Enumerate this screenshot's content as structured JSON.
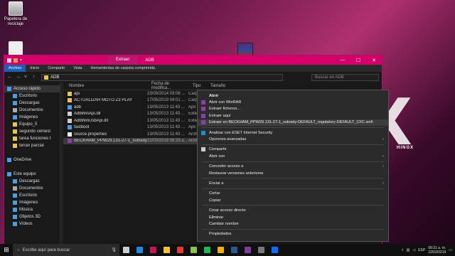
{
  "desktop": {
    "recycle_bin_label": "Papelera de reciclaje",
    "brand_text": "HINOX",
    "big_letter": "X"
  },
  "window": {
    "tab_extract": "Extraer",
    "title": "ADB",
    "ribbon_tabs": [
      "Archivo",
      "Inicio",
      "Compartir",
      "Vista",
      "Herramientas de carpeta comprimida"
    ],
    "address": "ADB",
    "search_placeholder": "Buscar en ADB",
    "controls": {
      "minimize": "—",
      "maximize": "☐",
      "close": "✕"
    }
  },
  "nav_pane": [
    {
      "label": "Acceso rápido",
      "indent": false,
      "color": "#4a9de0"
    },
    {
      "label": "Escritorio",
      "indent": true,
      "color": "#4a9de0"
    },
    {
      "label": "Descargas",
      "indent": true,
      "color": "#4a9de0"
    },
    {
      "label": "Documentos",
      "indent": true,
      "color": "#aaaaaa"
    },
    {
      "label": "Imágenes",
      "indent": true,
      "color": "#4a9de0"
    },
    {
      "label": "Equipo_5",
      "indent": true,
      "color": "#e8c35a"
    },
    {
      "label": "segundo cemest",
      "indent": true,
      "color": "#e8c35a"
    },
    {
      "label": "tarea funciones t",
      "indent": true,
      "color": "#e8c35a"
    },
    {
      "label": "tercer parcial",
      "indent": true,
      "color": "#e8c35a"
    },
    {
      "label": "",
      "indent": false,
      "color": ""
    },
    {
      "label": "OneDrive",
      "indent": false,
      "color": "#4a9de0"
    },
    {
      "label": "",
      "indent": false,
      "color": ""
    },
    {
      "label": "Este equipo",
      "indent": false,
      "color": "#4a9de0"
    },
    {
      "label": "Descargas",
      "indent": true,
      "color": "#4a9de0"
    },
    {
      "label": "Documentos",
      "indent": true,
      "color": "#aaaaaa"
    },
    {
      "label": "Escritorio",
      "indent": true,
      "color": "#4a9de0"
    },
    {
      "label": "Imágenes",
      "indent": true,
      "color": "#4a9de0"
    },
    {
      "label": "Música",
      "indent": true,
      "color": "#4a9de0"
    },
    {
      "label": "Objetos 3D",
      "indent": true,
      "color": "#4a9de0"
    },
    {
      "label": "Vídeos",
      "indent": true,
      "color": "#4a9de0"
    }
  ],
  "file_columns": [
    "Nombre",
    "Fecha de modifica...",
    "Tipo",
    "Tamaño"
  ],
  "files": [
    {
      "name": "api",
      "date": "23/09/2014 03:06 ...",
      "type": "Carp",
      "icon": "folder"
    },
    {
      "name": "ACTUALIZAR MOTO Z3 PLAY",
      "date": "17/05/2019 04:01 ...",
      "type": "Carp",
      "icon": "folder"
    },
    {
      "name": "adb",
      "date": "13/05/2013 11:43 ...",
      "type": "Apli",
      "icon": "exe"
    },
    {
      "name": "AdbWinApi.dll",
      "date": "13/05/2013 11:43 ...",
      "type": "Exte",
      "icon": "dll"
    },
    {
      "name": "AdbWinUsbApi.dll",
      "date": "13/05/2013 11:43 ...",
      "type": "Exte",
      "icon": "dll"
    },
    {
      "name": "fastboot",
      "date": "13/05/2013 11:43 ...",
      "type": "Apli",
      "icon": "exe"
    },
    {
      "name": "source.properties",
      "date": "13/05/2013 11:43 ...",
      "type": "Arch",
      "icon": "file"
    },
    {
      "name": "BECKHAM_PPW29.131-27-1_subsidy-DEF...",
      "date": "22/03/2019 08:29 a...",
      "type": "Arch",
      "icon": "rar"
    }
  ],
  "context_menu": [
    {
      "label": "Abrir",
      "bold": true,
      "icon": "",
      "arrow": false,
      "sep_after": false
    },
    {
      "label": "Abrir con WinRAR",
      "bold": false,
      "icon": "rar",
      "arrow": false,
      "sep_after": false
    },
    {
      "label": "Extraer ficheros...",
      "bold": false,
      "icon": "rar",
      "arrow": false,
      "sep_after": false
    },
    {
      "label": "Extraer aquí",
      "bold": false,
      "icon": "rar",
      "arrow": false,
      "sep_after": false
    },
    {
      "label": "Extraer en BECKHAM_PPW29.131-27-1_subsidy-DEFAULT_regulatory-DEFAULT_CFC.xml\\",
      "bold": false,
      "icon": "rar",
      "arrow": false,
      "sep_after": true,
      "highlight": true
    },
    {
      "label": "Analizar con ESET Internet Security",
      "bold": false,
      "icon": "eset",
      "arrow": false,
      "sep_after": false
    },
    {
      "label": "Opciones avanzadas",
      "bold": false,
      "icon": "",
      "arrow": true,
      "sep_after": true
    },
    {
      "label": "Compartir",
      "bold": false,
      "icon": "share",
      "arrow": false,
      "sep_after": false
    },
    {
      "label": "Abrir con",
      "bold": false,
      "icon": "",
      "arrow": true,
      "sep_after": true
    },
    {
      "label": "Conceder acceso a",
      "bold": false,
      "icon": "",
      "arrow": true,
      "sep_after": false
    },
    {
      "label": "Restaurar versiones anteriores",
      "bold": false,
      "icon": "",
      "arrow": false,
      "sep_after": true
    },
    {
      "label": "Enviar a",
      "bold": false,
      "icon": "",
      "arrow": true,
      "sep_after": true
    },
    {
      "label": "Cortar",
      "bold": false,
      "icon": "",
      "arrow": false,
      "sep_after": false
    },
    {
      "label": "Copiar",
      "bold": false,
      "icon": "",
      "arrow": false,
      "sep_after": true
    },
    {
      "label": "Crear acceso directo",
      "bold": false,
      "icon": "",
      "arrow": false,
      "sep_after": false
    },
    {
      "label": "Eliminar",
      "bold": false,
      "icon": "",
      "arrow": false,
      "sep_after": false
    },
    {
      "label": "Cambiar nombre",
      "bold": false,
      "icon": "",
      "arrow": false,
      "sep_after": true
    },
    {
      "label": "Propiedades",
      "bold": false,
      "icon": "",
      "arrow": false,
      "sep_after": false
    }
  ],
  "taskbar": {
    "search_placeholder": "Escribe aquí para buscar",
    "apps": [
      {
        "name": "task-view",
        "color": "#cccccc"
      },
      {
        "name": "edge",
        "color": "#1e88e5"
      },
      {
        "name": "photos",
        "color": "#c2185b"
      },
      {
        "name": "store",
        "color": "#fbc02d"
      },
      {
        "name": "chrome",
        "color": "#e53935"
      },
      {
        "name": "android-studio",
        "color": "#8bc34a"
      },
      {
        "name": "spotify",
        "color": "#1db954"
      },
      {
        "name": "explorer",
        "color": "#f0b400"
      },
      {
        "name": "word",
        "color": "#2b5797"
      },
      {
        "name": "winrar",
        "color": "#7b3fa0"
      },
      {
        "name": "media",
        "color": "#777777"
      },
      {
        "name": "photoshop",
        "color": "#0d6efd"
      }
    ],
    "language": "ESP",
    "time": "08:31 a. m.",
    "date": "22/03/2019"
  }
}
